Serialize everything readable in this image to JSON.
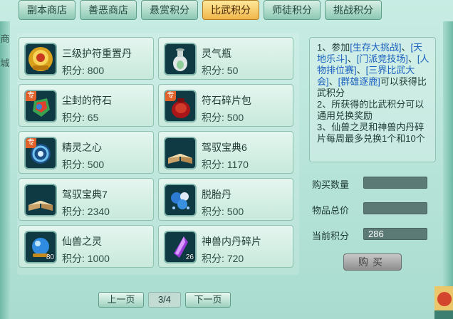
{
  "tabs": [
    {
      "label": "副本商店",
      "active": false
    },
    {
      "label": "善恶商店",
      "active": false
    },
    {
      "label": "悬赏积分",
      "active": false
    },
    {
      "label": "比武积分",
      "active": true
    },
    {
      "label": "师徒积分",
      "active": false
    },
    {
      "label": "挑战积分",
      "active": false
    }
  ],
  "left_strip": [
    "商",
    "城"
  ],
  "items": [
    {
      "name": "三级护符重置丹",
      "points": "积分: 800",
      "icon": "gold-dan-icon",
      "badge": "",
      "qty": ""
    },
    {
      "name": "灵气瓶",
      "points": "积分: 50",
      "icon": "vase-icon",
      "badge": "",
      "qty": ""
    },
    {
      "name": "尘封的符石",
      "points": "积分: 65",
      "icon": "gem-stone-icon",
      "badge": "专",
      "qty": ""
    },
    {
      "name": "符石碎片包",
      "points": "积分: 500",
      "icon": "red-bag-icon",
      "badge": "专",
      "qty": ""
    },
    {
      "name": "精灵之心",
      "points": "积分: 500",
      "icon": "spirit-heart-icon",
      "badge": "专",
      "qty": ""
    },
    {
      "name": "驾驭宝典6",
      "points": "积分: 1170",
      "icon": "book-icon",
      "badge": "",
      "qty": ""
    },
    {
      "name": "驾驭宝典7",
      "points": "积分: 2340",
      "icon": "book-icon",
      "badge": "",
      "qty": ""
    },
    {
      "name": "脱胎丹",
      "points": "积分: 500",
      "icon": "blue-pill-icon",
      "badge": "",
      "qty": ""
    },
    {
      "name": "仙兽之灵",
      "points": "积分: 1000",
      "icon": "blue-orb-icon",
      "badge": "",
      "qty": "80"
    },
    {
      "name": "神兽内丹碎片",
      "points": "积分: 720",
      "icon": "purple-crystal-icon",
      "badge": "",
      "qty": "26"
    }
  ],
  "info": {
    "line1_a": "1、参加",
    "line1_b": "[生存大挑战]",
    "line1_c": "、",
    "line1_d": "[天地乐斗]",
    "line1_e": "、",
    "line1_f": "[门派竞技场]",
    "line1_g": "、",
    "line1_h": "[人物排位赛]",
    "line1_i": "、",
    "line1_j": "[三界比武大会]",
    "line1_k": "、",
    "line1_l": "[群雄逐鹿]",
    "line1_m": "可以获得比武积分",
    "line2": "2、所获得的比武积分可以通用兑换奖励",
    "line3": "3、仙兽之灵和神兽内丹碎片每周最多兑换1个和10个"
  },
  "form": {
    "qty_label": "购买数量",
    "qty_value": "",
    "total_label": "物品总价",
    "total_value": "",
    "current_label": "当前积分",
    "current_value": "286"
  },
  "buy_label": "购买",
  "pager": {
    "prev": "上一页",
    "page": "3/4",
    "next": "下一页"
  },
  "colors": {
    "accent": "#f0b64a",
    "link": "#1a5fbf"
  }
}
